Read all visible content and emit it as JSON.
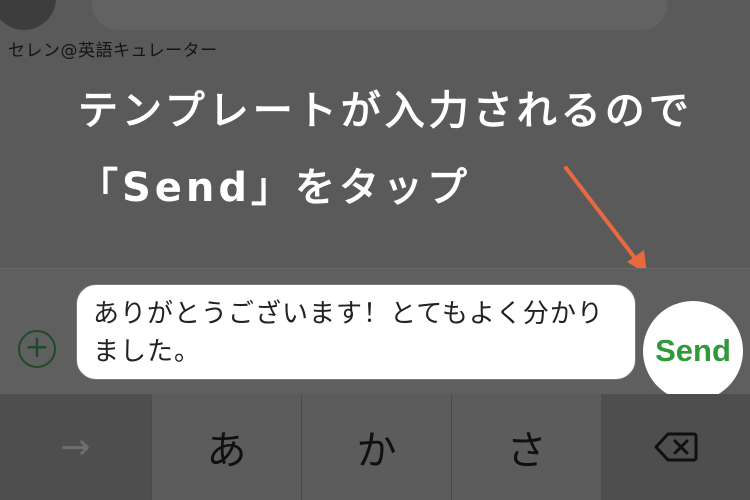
{
  "chat": {
    "sender_name": "セレン@英語キュレーター"
  },
  "overlay": {
    "caption_line1": "テンプレートが入力されるので",
    "caption_line2": "「Send」をタップ",
    "arrow_color": "#e9683f"
  },
  "composer": {
    "plus_label": "+",
    "input_value": "ありがとうございます！とてもよく分かりました。",
    "send_label": "Send",
    "send_color": "#2e9a3a"
  },
  "keyboard": {
    "next_label": "→",
    "keys": [
      "あ",
      "か",
      "さ"
    ],
    "delete_icon": "backspace-icon"
  }
}
